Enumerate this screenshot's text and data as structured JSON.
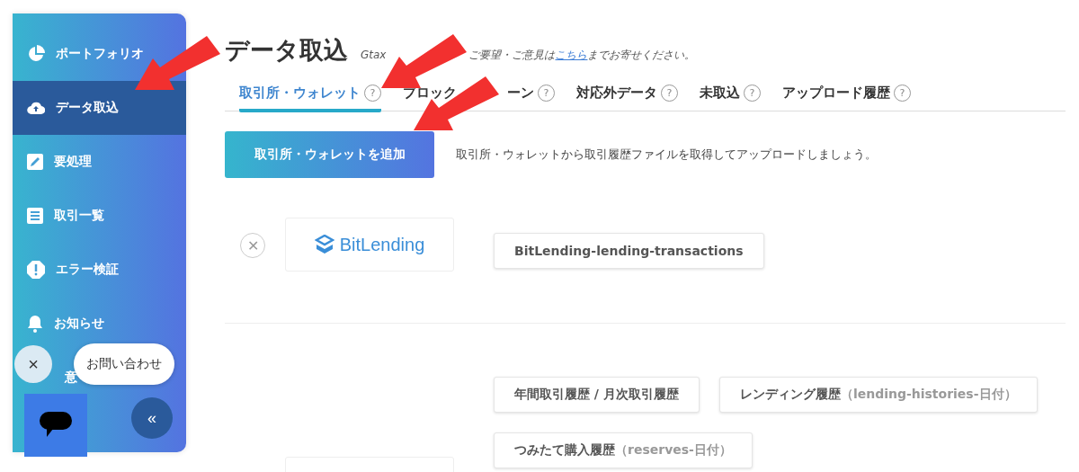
{
  "sidebar": {
    "items": [
      {
        "label": "ポートフォリオ",
        "selected": false
      },
      {
        "label": "データ取込",
        "selected": true
      },
      {
        "label": "要処理",
        "selected": false
      },
      {
        "label": "取引一覧",
        "selected": false
      },
      {
        "label": "エラー検証",
        "selected": false
      },
      {
        "label": "お知らせ",
        "selected": false
      },
      {
        "label": "意",
        "selected": false
      }
    ]
  },
  "chat_widget": {
    "bubble": "お問い合わせ",
    "close": "×",
    "collapse": "«"
  },
  "header": {
    "title": "データ取込",
    "note_start": "Gtax",
    "note": "ご要望・ご意見は",
    "link": "こちら",
    "note_end": "までお寄せください。"
  },
  "tabs": [
    {
      "label": "取引所・ウォレット",
      "selected": true
    },
    {
      "label": "ブロック",
      "tail": "ーン",
      "selected": false
    },
    {
      "label": "対応外データ",
      "selected": false
    },
    {
      "label": "未取込",
      "selected": false
    },
    {
      "label": "アップロード履歴",
      "selected": false
    }
  ],
  "help_mark": "?",
  "add_button": "取引所・ウォレットを追加",
  "add_hint": "取引所・ウォレットから取引履歴ファイルを取得してアップロードしましょう。",
  "exchanges": [
    {
      "logo_text": "BitLending",
      "remove_mark": "✕",
      "files": [
        [
          {
            "label": "BitLending-lending-transactions"
          }
        ]
      ]
    },
    {
      "files": [
        [
          {
            "label": "年間取引履歴 / 月次取引履歴"
          },
          {
            "label": "レンディング履歴",
            "note": "（lending-histories-日付）"
          }
        ],
        [
          {
            "label": "つみたて購入履歴",
            "note": "（reserves-日付）"
          }
        ]
      ]
    }
  ]
}
